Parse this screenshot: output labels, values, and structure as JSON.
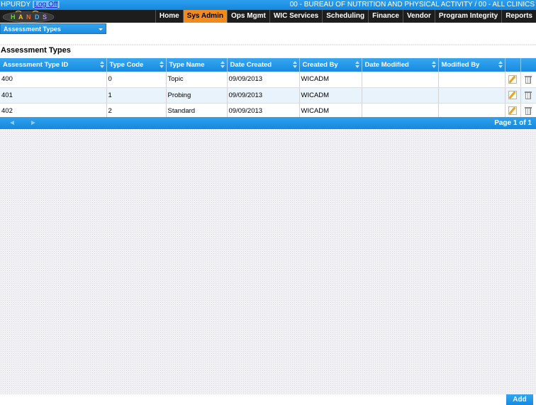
{
  "topbar": {
    "user": "HPURDY",
    "logoff": "Log Off",
    "agency": "00 - BUREAU OF NUTRITION AND PHYSICAL ACTIVITY / 00 - ALL CLINICS"
  },
  "logo": {
    "text": "HANDS"
  },
  "nav": {
    "items": [
      "Home",
      "Sys Admin",
      "Ops Mgmt",
      "WIC Services",
      "Scheduling",
      "Finance",
      "Vendor",
      "Program Integrity",
      "Reports"
    ],
    "active": "Sys Admin"
  },
  "dropdown": {
    "value": "Assessment Types",
    "icon": "chevron-down-icon"
  },
  "page": {
    "title": "Assessment Types"
  },
  "table": {
    "columns": [
      "Assessment Type ID",
      "Type Code",
      "Type Name",
      "Date Created",
      "Created By",
      "Date Modified",
      "Modified By"
    ],
    "rows": [
      [
        "400",
        "0",
        "Topic",
        "09/09/2013",
        "WICADM",
        "",
        ""
      ],
      [
        "401",
        "1",
        "Probing",
        "09/09/2013",
        "WICADM",
        "",
        ""
      ],
      [
        "402",
        "2",
        "Standard",
        "09/09/2013",
        "WICADM",
        "",
        ""
      ]
    ]
  },
  "pager": {
    "prev": "◄",
    "next": "►",
    "info": "Page 1 of 1"
  },
  "footer": {
    "add_label": "Add"
  },
  "colors": {
    "accent": "#1a8be0",
    "active_tab": "#f28a1c",
    "nav_bg": "#1d1d1d"
  }
}
